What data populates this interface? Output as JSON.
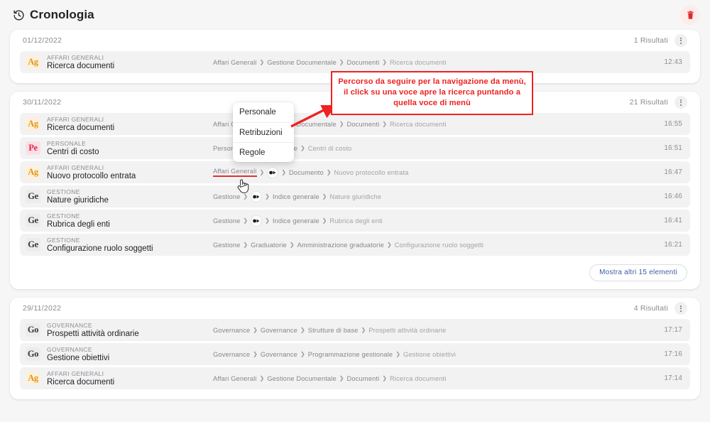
{
  "header": {
    "title": "Cronologia",
    "clock_icon": "history-clock-icon",
    "delete_icon": "trash-icon",
    "delete_color": "#e02b2b"
  },
  "annotation": {
    "text": "Percorso da seguire per la navigazione da menù, il click su una voce apre la ricerca puntando a quella voce di menù",
    "color": "#ee2222"
  },
  "dropdown": {
    "items": [
      {
        "label": "Personale"
      },
      {
        "label": "Retribuzioni"
      },
      {
        "label": "Regole"
      }
    ]
  },
  "cards": [
    {
      "date": "01/12/2022",
      "count": "1 Risultati",
      "kebab_icon": "more-vertical-icon",
      "show_more": null,
      "rows": [
        {
          "badge": "Ag",
          "badge_kind": "ag",
          "category": "AFFARI GENERALI",
          "title": "Ricerca documenti",
          "crumbs": [
            "Affari Generali",
            "Gestione Documentale",
            "Documenti",
            "Ricerca documenti"
          ],
          "time": "12:43"
        }
      ]
    },
    {
      "date": "30/11/2022",
      "count": "21 Risultati",
      "kebab_icon": "more-vertical-icon",
      "show_more": "Mostra altri 15 elementi",
      "rows": [
        {
          "badge": "Ag",
          "badge_kind": "ag",
          "category": "AFFARI GENERALI",
          "title": "Ricerca documenti",
          "crumbs": [
            "Affari Generali",
            "Gestione Documentale",
            "Documenti",
            "Ricerca documenti"
          ],
          "time": "16:55"
        },
        {
          "badge": "Pe",
          "badge_kind": "pe",
          "category": "PERSONALE",
          "title": "Centri di costo",
          "crumbs": [
            "Personale",
            "__MORE__",
            "Regole",
            "Centri di costo"
          ],
          "time": "16:51"
        },
        {
          "badge": "Ag",
          "badge_kind": "ag",
          "category": "AFFARI GENERALI",
          "title": "Nuovo protocollo entrata",
          "crumbs": [
            "Affari Generali",
            "__MORE__",
            "Documento",
            "Nuovo protocollo entrata"
          ],
          "time": "16:47",
          "underline_first": true
        },
        {
          "badge": "Ge",
          "badge_kind": "ge",
          "category": "GESTIONE",
          "title": "Nature giuridiche",
          "crumbs": [
            "Gestione",
            "__MORE__",
            "Indice generale",
            "Nature giuridiche"
          ],
          "time": "16:46"
        },
        {
          "badge": "Ge",
          "badge_kind": "ge",
          "category": "GESTIONE",
          "title": "Rubrica degli enti",
          "crumbs": [
            "Gestione",
            "__MORE__",
            "Indice generale",
            "Rubrica degli enti"
          ],
          "time": "16:41"
        },
        {
          "badge": "Ge",
          "badge_kind": "ge",
          "category": "GESTIONE",
          "title": "Configurazione ruolo soggetti",
          "crumbs": [
            "Gestione",
            "Graduatorie",
            "Amministrazione graduatorie",
            "Configurazione ruolo soggetti"
          ],
          "time": "16:21"
        }
      ]
    },
    {
      "date": "29/11/2022",
      "count": "4 Risultati",
      "kebab_icon": "more-vertical-icon",
      "show_more": null,
      "rows": [
        {
          "badge": "Go",
          "badge_kind": "go",
          "category": "GOVERNANCE",
          "title": "Prospetti attività ordinarie",
          "crumbs": [
            "Governance",
            "Governance",
            "Strutture di base",
            "Prospetti attività ordinarie"
          ],
          "time": "17:17"
        },
        {
          "badge": "Go",
          "badge_kind": "go",
          "category": "GOVERNANCE",
          "title": "Gestione obiettivi",
          "crumbs": [
            "Governance",
            "Governance",
            "Programmazione gestionale",
            "Gestione obiettivi"
          ],
          "time": "17:16"
        },
        {
          "badge": "Ag",
          "badge_kind": "ag",
          "category": "AFFARI GENERALI",
          "title": "Ricerca documenti",
          "crumbs": [
            "Affari Generali",
            "Gestione Documentale",
            "Documenti",
            "Ricerca documenti"
          ],
          "time": "17:14"
        }
      ]
    }
  ]
}
